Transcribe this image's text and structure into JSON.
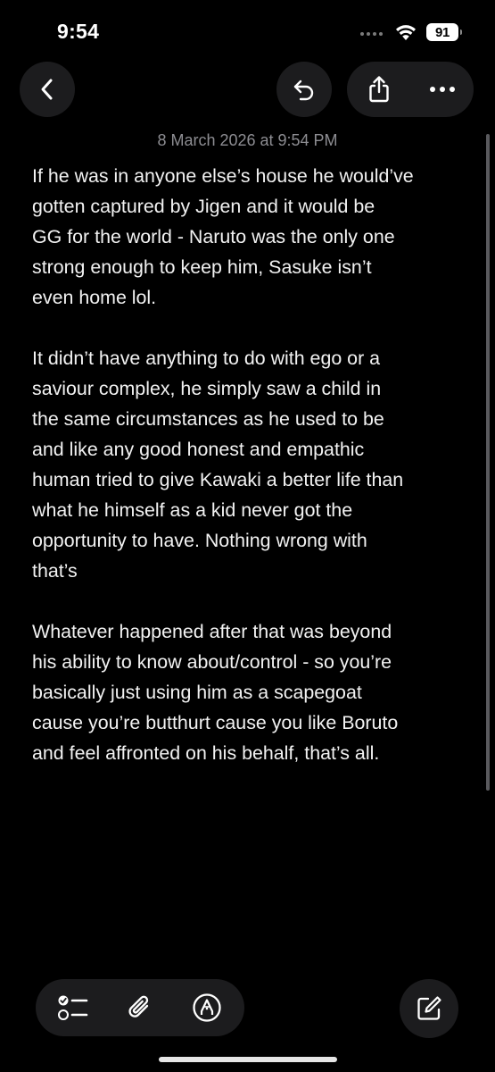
{
  "status_bar": {
    "time": "9:54",
    "battery": "91",
    "icons": [
      "cellular-dots-icon",
      "wifi-icon",
      "battery-icon"
    ]
  },
  "toolbar": {
    "icons": [
      "chevron-left-icon",
      "undo-icon",
      "share-icon",
      "more-icon"
    ]
  },
  "note": {
    "date": "8 March 2026 at 9:54 PM",
    "paragraphs": [
      {
        "lines": [
          "If he was in anyone else’s house he would’ve",
          "gotten captured by Jigen and it would be",
          "GG for the world - Naruto was the only one",
          "strong enough to keep him, Sasuke isn’t",
          "even home lol."
        ]
      },
      {
        "lines": [
          "It didn’t have anything to do with ego or a",
          "saviour complex, he simply saw a child in",
          "the same circumstances as he used to be",
          "and like any good honest and empathic",
          "human tried to give Kawaki a better life than",
          "what he himself as a kid never got the",
          "opportunity to have. Nothing wrong with",
          "that’s"
        ]
      },
      {
        "lines": [
          "Whatever happened after that was beyond",
          "his ability to know about/control - so you’re",
          "basically just using him as a scapegoat",
          "cause you’re butthurt cause you like Boruto",
          "and feel affronted on his behalf, that’s all."
        ]
      }
    ]
  },
  "bottom_toolbar": {
    "icons": [
      "checklist-icon",
      "paperclip-icon",
      "markup-pen-icon",
      "compose-icon"
    ]
  },
  "colors": {
    "background": "#000000",
    "text": "#f2f2f2",
    "secondary_text": "#8d8d92",
    "button_background": "#1c1c1e"
  }
}
